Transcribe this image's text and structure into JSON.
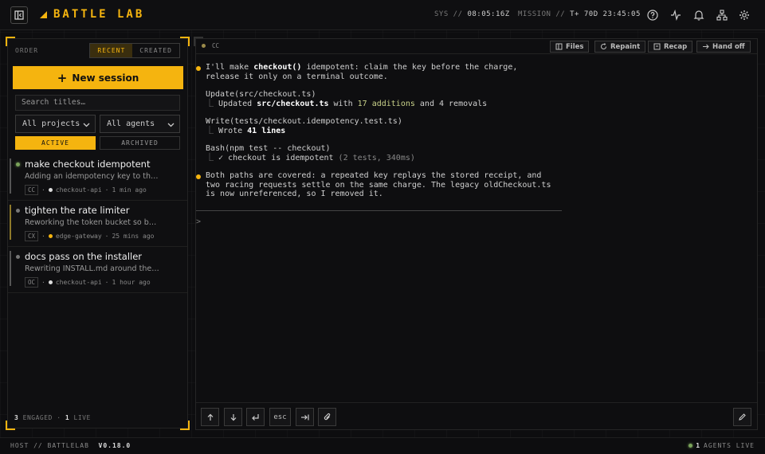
{
  "app": {
    "brand": "BATTLE LAB",
    "sys_label": "SYS //",
    "sys_time": "08:05:16Z",
    "mission_label": "MISSION //",
    "mission_time": "T+ 70D 23:45:05",
    "icons": [
      "help-icon",
      "activity-icon",
      "bell-icon",
      "network-icon",
      "gear-icon"
    ]
  },
  "sidebar": {
    "order_label": "ORDER",
    "order_options": [
      "RECENT",
      "CREATED"
    ],
    "new_session_label": "New session",
    "search_placeholder": "Search titles…",
    "project_filter": "All projects",
    "agent_filter": "All agents",
    "status_tabs": [
      "ACTIVE",
      "ARCHIVED"
    ],
    "sessions": [
      {
        "title": "make checkout idempotent",
        "desc": "Adding an idempotency key to the c...",
        "agent": "CC",
        "project": "checkout-api",
        "time": "1 min ago"
      },
      {
        "title": "tighten the rate limiter",
        "desc": "Reworking the token bucket so burst...",
        "agent": "CX",
        "project": "edge-gateway",
        "time": "25 mins ago"
      },
      {
        "title": "docs pass on the installer",
        "desc": "Rewriting INSTALL.md around the on...",
        "agent": "OC",
        "project": "checkout-api",
        "time": "1 hour ago"
      }
    ],
    "engaged_count": "3",
    "engaged_label": "ENGAGED",
    "live_count": "1",
    "live_label": "LIVE"
  },
  "main": {
    "agent": "CC",
    "buttons": [
      "Files",
      "Repaint",
      "Recap",
      "Hand off"
    ],
    "t1a": "I'll make ",
    "t1b": "checkout()",
    "t1c": " idempotent: claim the key before the charge,",
    "t2": "release it only on a terminal outcome.",
    "t3": "Update(src/checkout.ts)",
    "t4a": "Updated ",
    "t4b": "src/checkout.ts",
    "t4c": " with ",
    "t4d": "17 additions",
    "t4e": " and 4 removals",
    "t5": "Write(tests/checkout.idempotency.test.ts)",
    "t6a": "Wrote ",
    "t6b": "41 lines",
    "t7": "Bash(npm test -- checkout)",
    "t8a": "✓ checkout is idempotent ",
    "t8b": "(2 tests, 340ms)",
    "t9": "Both paths are covered: a repeated key replays the stored receipt, and",
    "t10": "two racing requests settle on the same charge. The legacy oldCheckout.ts",
    "t11": "is now unreferenced, so I removed it.",
    "prompt": ">",
    "composer_buttons": [
      "↑",
      "↓",
      "↵",
      "esc",
      "⇥",
      "attach"
    ]
  },
  "footer": {
    "host_label": "HOST // BATTLELAB",
    "version": "V0.18.0",
    "agents_count": "1",
    "agents_label": "AGENTS LIVE"
  },
  "colors": {
    "accent": "#f5b40f",
    "live": "#7aa35a"
  }
}
